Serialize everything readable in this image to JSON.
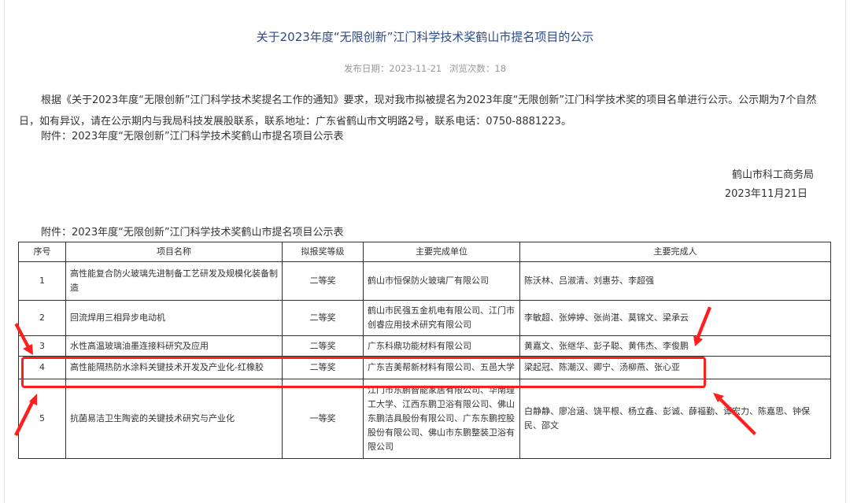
{
  "title": "关于2023年度“无限创新”江门科学技术奖鹤山市提名项目的公示",
  "meta": {
    "date": "发布日期：2023-11-21",
    "views": "浏览次数：18"
  },
  "body": {
    "paragraph": "根据《关于2023年度“无限创新”江门科学技术奖提名工作的通知》要求，现对我市拟被提名为2023年度“无限创新”江门科学技术奖的项目名单进行公示。公示期为7个自然日，如有异议，请在公示期内与我局科技发展股联系，联系地址：广东省鹤山市文明路2号，联系电话：0750-8881223。",
    "attachment": "附件：2023年度“无限创新”江门科学技术奖鹤山市提名项目公示表"
  },
  "signature": {
    "org": "鹤山市科工商务局",
    "date": "2023年11月21日"
  },
  "table": {
    "caption": "附件：2023年度“无限创新”江门科学技术奖鹤山市提名项目公示表",
    "headers": [
      "序号",
      "项目名称",
      "拟报奖等级",
      "主要完成单位",
      "主要完成人"
    ],
    "rows": [
      [
        "1",
        "高性能复合防火玻璃先进制备工艺研发及规模化装备制造",
        "二等奖",
        "鹤山市恒保防火玻璃厂有限公司",
        "陈沃林、吕淑清、刘惠芬、李超强"
      ],
      [
        "2",
        "回流焊用三相异步电动机",
        "二等奖",
        "鹤山市民强五金机电有限公司、江门市创睿应用技术研究有限公司",
        "李敏超、张婷婷、张尚湛、莫锦文、梁承云"
      ],
      [
        "3",
        "水性高温玻璃油墨连接料研究及应用",
        "二等奖",
        "广东科鼎功能材料有限公司",
        "黄嘉文、张继华、彭子聪、黄伟杰、李俊鹏"
      ],
      [
        "4",
        "高性能隔热防水涂料关键技术开发及产业化-红橡胶",
        "二等奖",
        "广东吉美帮新材料有限公司、五邑大学",
        "梁起冠、陈潮汉、卿宁、汤柳燕、张心亚"
      ],
      [
        "5",
        "抗菌易洁卫生陶瓷的关键技术研究与产业化",
        "一等奖",
        "江门市东鹏智能家居有限公司、华南理工大学、江西东鹏卫浴有限公司、佛山东鹏洁具股份有限公司、广东东鹏控股股份有限公司、佛山市东鹏整装卫浴有限公司",
        "白静静、廖冶涵、饶平根、杨立鑫、彭诚、薛福勤、谭宏力、陈嘉思、钟保民、邵文"
      ]
    ]
  },
  "annotation": {
    "highlight_color": "#ff1e1e"
  }
}
